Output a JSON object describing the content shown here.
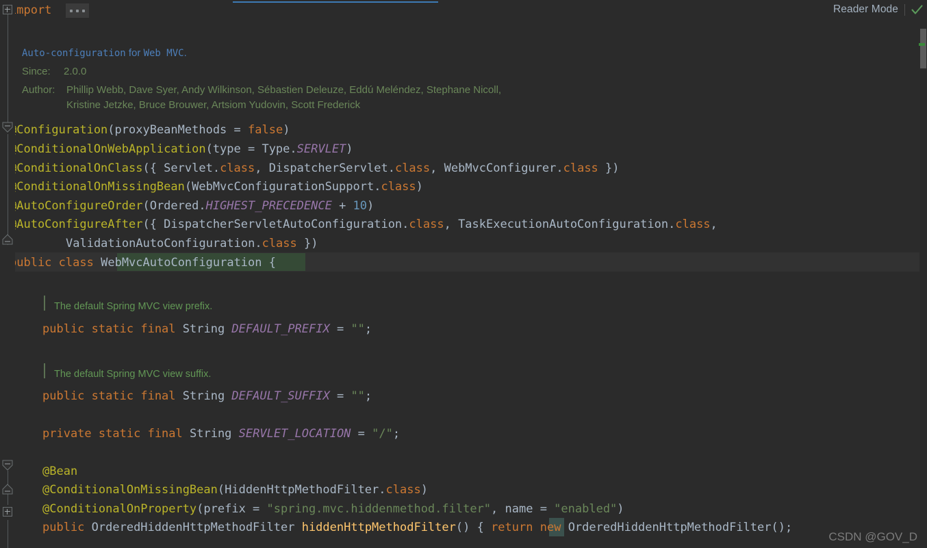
{
  "editor": {
    "language": "java",
    "background": "#2b2b2b",
    "caret_line_background": "#323232",
    "reader_mode": {
      "label": "Reader Mode",
      "check_icon": "check-icon",
      "check_color": "#5b9a5b"
    },
    "fold_placeholder": "..."
  },
  "colors": {
    "keyword": "#cc7832",
    "annotation": "#bbb529",
    "identifier": "#a9b7c6",
    "constant": "#9876aa",
    "string": "#6a8759",
    "number": "#6897bb",
    "method": "#ffc66d",
    "comment": "#629755",
    "link": "#4d7fba",
    "accent_blue": "#3d7ab5"
  },
  "import_line": {
    "keyword": "import",
    "folded": "..."
  },
  "javadoc": {
    "summary_prefix": "Auto-configuration",
    "summary_mid": " for ",
    "summary_suffix": "Web MVC",
    "summary_end": ".",
    "since_label": "Since:",
    "since_value": "2.0.0",
    "author_label": "Author:",
    "author_line_1": "Phillip Webb, Dave Syer, Andy Wilkinson, Sébastien Deleuze, Eddú Meléndez, Stephane Nicoll,",
    "author_line_2": "Kristine Jetzke, Bruce Brouwer, Artsiom Yudovin, Scott Frederick"
  },
  "annotations": [
    {
      "name": "@Configuration",
      "segments": [
        {
          "t": "@Configuration",
          "c": "ann"
        },
        {
          "t": "(proxyBeanMethods = ",
          "c": "id"
        },
        {
          "t": "false",
          "c": "kw"
        },
        {
          "t": ")",
          "c": "id"
        }
      ]
    },
    {
      "name": "@ConditionalOnWebApplication",
      "segments": [
        {
          "t": "@ConditionalOnWebApplication",
          "c": "ann"
        },
        {
          "t": "(type = Type.",
          "c": "id"
        },
        {
          "t": "SERVLET",
          "c": "cst"
        },
        {
          "t": ")",
          "c": "id"
        }
      ]
    },
    {
      "name": "@ConditionalOnClass",
      "segments": [
        {
          "t": "@ConditionalOnClass",
          "c": "ann"
        },
        {
          "t": "({ Servlet.",
          "c": "id"
        },
        {
          "t": "class",
          "c": "cls"
        },
        {
          "t": ", DispatcherServlet.",
          "c": "id"
        },
        {
          "t": "class",
          "c": "cls"
        },
        {
          "t": ", WebMvcConfigurer.",
          "c": "id"
        },
        {
          "t": "class",
          "c": "cls"
        },
        {
          "t": " })",
          "c": "id"
        }
      ]
    },
    {
      "name": "@ConditionalOnMissingBean",
      "segments": [
        {
          "t": "@ConditionalOnMissingBean",
          "c": "ann"
        },
        {
          "t": "(WebMvcConfigurationSupport.",
          "c": "id"
        },
        {
          "t": "class",
          "c": "cls"
        },
        {
          "t": ")",
          "c": "id"
        }
      ]
    },
    {
      "name": "@AutoConfigureOrder",
      "segments": [
        {
          "t": "@AutoConfigureOrder",
          "c": "ann"
        },
        {
          "t": "(Ordered.",
          "c": "id"
        },
        {
          "t": "HIGHEST_PRECEDENCE",
          "c": "cst"
        },
        {
          "t": " + ",
          "c": "id"
        },
        {
          "t": "10",
          "c": "num"
        },
        {
          "t": ")",
          "c": "id"
        }
      ]
    },
    {
      "name": "@AutoConfigureAfter",
      "segments": [
        {
          "t": "@AutoConfigureAfter",
          "c": "ann"
        },
        {
          "t": "({ DispatcherServletAutoConfiguration.",
          "c": "id"
        },
        {
          "t": "class",
          "c": "cls"
        },
        {
          "t": ", TaskExecutionAutoConfiguration.",
          "c": "id"
        },
        {
          "t": "class",
          "c": "cls"
        },
        {
          "t": ",",
          "c": "id"
        }
      ]
    },
    {
      "name": "@AutoConfigureAfter-continued",
      "indent": 8,
      "segments": [
        {
          "t": "ValidationAutoConfiguration.",
          "c": "id"
        },
        {
          "t": "class",
          "c": "cls"
        },
        {
          "t": " })",
          "c": "id"
        }
      ]
    }
  ],
  "class_declaration": {
    "segments": [
      {
        "t": "public",
        "c": "kw"
      },
      {
        "t": " ",
        "c": "id"
      },
      {
        "t": "class",
        "c": "kw"
      },
      {
        "t": " ",
        "c": "id"
      },
      {
        "t": "WebMvcAutoConfiguration",
        "c": "id"
      },
      {
        "t": " {",
        "c": "id"
      }
    ],
    "name": "WebMvcAutoConfiguration"
  },
  "fields": [
    {
      "doc": "The default Spring MVC view prefix.",
      "segments": [
        {
          "t": "public",
          "c": "kw"
        },
        {
          "t": " ",
          "c": "id"
        },
        {
          "t": "static",
          "c": "kw"
        },
        {
          "t": " ",
          "c": "id"
        },
        {
          "t": "final",
          "c": "kw"
        },
        {
          "t": " String ",
          "c": "id"
        },
        {
          "t": "DEFAULT_PREFIX",
          "c": "cst"
        },
        {
          "t": " = ",
          "c": "id"
        },
        {
          "t": "\"\"",
          "c": "str"
        },
        {
          "t": ";",
          "c": "id"
        }
      ]
    },
    {
      "doc": "The default Spring MVC view suffix.",
      "segments": [
        {
          "t": "public",
          "c": "kw"
        },
        {
          "t": " ",
          "c": "id"
        },
        {
          "t": "static",
          "c": "kw"
        },
        {
          "t": " ",
          "c": "id"
        },
        {
          "t": "final",
          "c": "kw"
        },
        {
          "t": " String ",
          "c": "id"
        },
        {
          "t": "DEFAULT_SUFFIX",
          "c": "cst"
        },
        {
          "t": " = ",
          "c": "id"
        },
        {
          "t": "\"\"",
          "c": "str"
        },
        {
          "t": ";",
          "c": "id"
        }
      ]
    },
    {
      "doc": "",
      "segments": [
        {
          "t": "private",
          "c": "kw"
        },
        {
          "t": " ",
          "c": "id"
        },
        {
          "t": "static",
          "c": "kw"
        },
        {
          "t": " ",
          "c": "id"
        },
        {
          "t": "final",
          "c": "kw"
        },
        {
          "t": " String ",
          "c": "id"
        },
        {
          "t": "SERVLET_LOCATION",
          "c": "cst"
        },
        {
          "t": " = ",
          "c": "id"
        },
        {
          "t": "\"/\"",
          "c": "str"
        },
        {
          "t": ";",
          "c": "id"
        }
      ]
    }
  ],
  "bean_method": {
    "lines": [
      {
        "name": "@Bean",
        "segments": [
          {
            "t": "@Bean",
            "c": "ann"
          }
        ]
      },
      {
        "name": "@ConditionalOnMissingBean",
        "segments": [
          {
            "t": "@ConditionalOnMissingBean",
            "c": "ann"
          },
          {
            "t": "(HiddenHttpMethodFilter.",
            "c": "id"
          },
          {
            "t": "class",
            "c": "cls"
          },
          {
            "t": ")",
            "c": "id"
          }
        ]
      },
      {
        "name": "@ConditionalOnProperty",
        "segments": [
          {
            "t": "@ConditionalOnProperty",
            "c": "ann"
          },
          {
            "t": "(prefix = ",
            "c": "id"
          },
          {
            "t": "\"spring.mvc.hiddenmethod.filter\"",
            "c": "str"
          },
          {
            "t": ", name = ",
            "c": "id"
          },
          {
            "t": "\"enabled\"",
            "c": "str"
          },
          {
            "t": ")",
            "c": "id"
          }
        ]
      },
      {
        "name": "method-signature",
        "segments": [
          {
            "t": "public",
            "c": "kw"
          },
          {
            "t": " OrderedHiddenHttpMethodFilter ",
            "c": "id"
          },
          {
            "t": "hiddenHttpMethodFilter",
            "c": "mth"
          },
          {
            "t": "() { ",
            "c": "id"
          },
          {
            "t": "return",
            "c": "kw"
          },
          {
            "t": " ",
            "c": "id"
          },
          {
            "t": "new",
            "c": "kw"
          },
          {
            "t": " OrderedHiddenHttpMethodFilter();",
            "c": "id"
          }
        ]
      }
    ]
  },
  "gutter": {
    "import_fold": "+",
    "class_fold_collapse": "−",
    "bean_fold_collapse": "−",
    "bean_fold_expand": "+"
  },
  "scrollbar": {
    "thumb_color": "#5c5c5c",
    "marker_color": "#3a8a3a"
  },
  "watermark": "CSDN @GOV_D"
}
